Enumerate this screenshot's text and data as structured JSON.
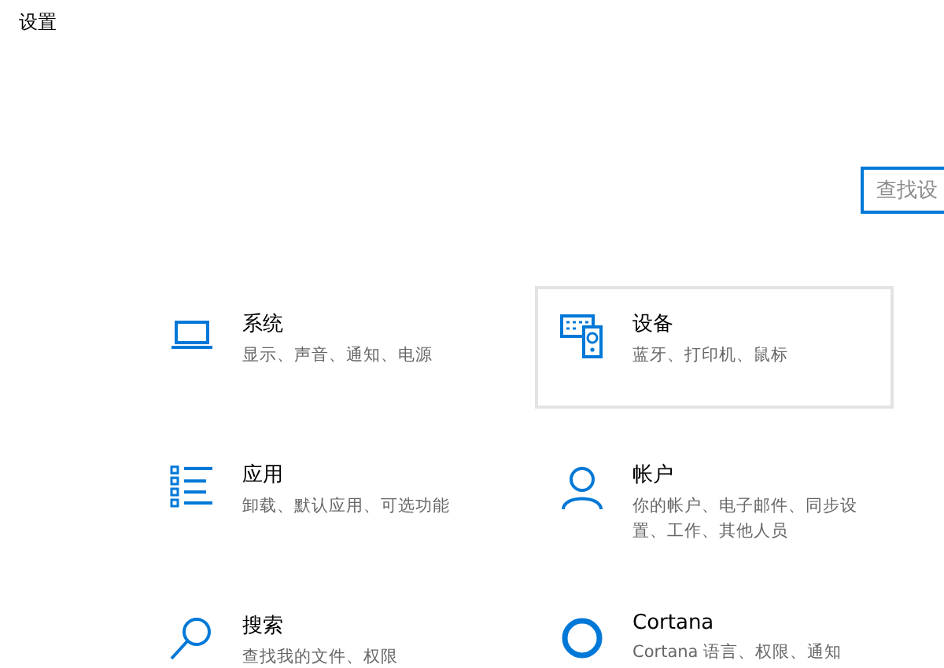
{
  "window": {
    "title": "设置"
  },
  "search": {
    "placeholder": "查找设"
  },
  "tiles": [
    {
      "title": "系统",
      "description": "显示、声音、通知、电源",
      "highlighted": false
    },
    {
      "title": "设备",
      "description": "蓝牙、打印机、鼠标",
      "highlighted": true
    },
    {
      "title": "应用",
      "description": "卸载、默认应用、可选功能",
      "highlighted": false
    },
    {
      "title": "帐户",
      "description": "你的帐户、电子邮件、同步设置、工作、其他人员",
      "highlighted": false
    },
    {
      "title": "搜索",
      "description": "查找我的文件、权限",
      "highlighted": false
    },
    {
      "title": "Cortana",
      "description": "Cortana 语言、权限、通知",
      "highlighted": false
    }
  ]
}
